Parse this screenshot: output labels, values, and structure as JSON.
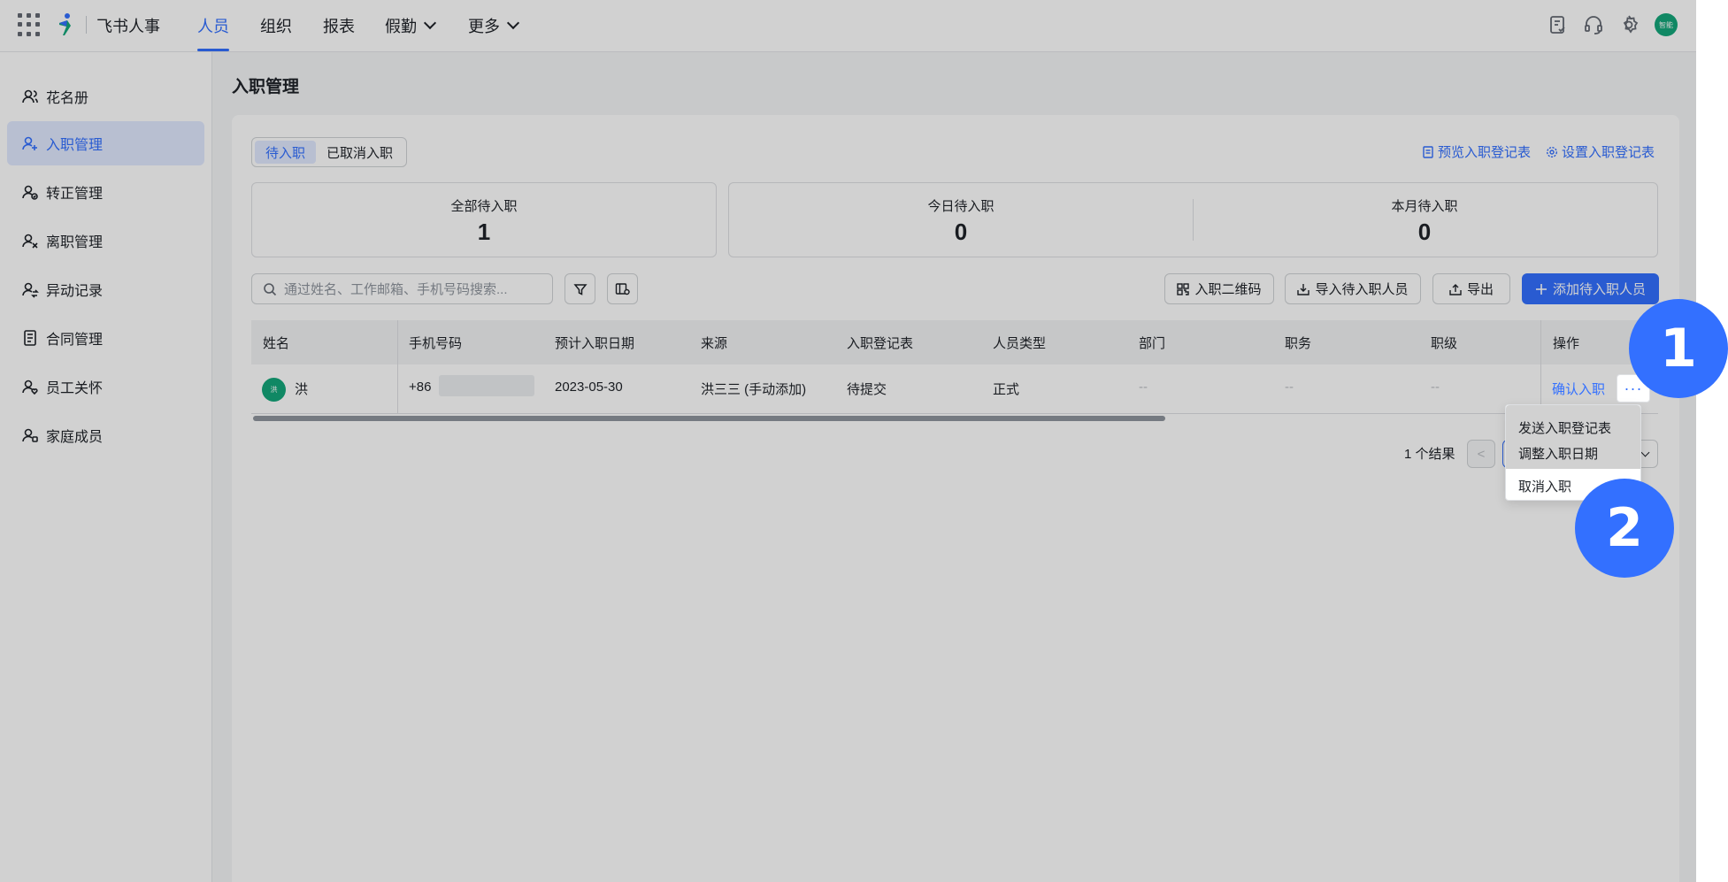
{
  "topbar": {
    "brand": "飞书人事",
    "nav": [
      "人员",
      "组织",
      "报表",
      "假勤",
      "更多"
    ],
    "avatar_text": "智能"
  },
  "sidebar": {
    "items": [
      {
        "label": "花名册",
        "icon": "roster-icon"
      },
      {
        "label": "入职管理",
        "icon": "onboarding-icon"
      },
      {
        "label": "转正管理",
        "icon": "regularization-icon"
      },
      {
        "label": "离职管理",
        "icon": "offboarding-icon"
      },
      {
        "label": "异动记录",
        "icon": "transfer-icon"
      },
      {
        "label": "合同管理",
        "icon": "contract-icon"
      },
      {
        "label": "员工关怀",
        "icon": "care-icon"
      },
      {
        "label": "家庭成员",
        "icon": "family-icon"
      }
    ]
  },
  "page": {
    "title": "入职管理",
    "tabs": [
      "待入职",
      "已取消入职"
    ],
    "preview_link": "预览入职登记表",
    "settings_link": "设置入职登记表"
  },
  "stats": [
    {
      "label": "全部待入职",
      "value": "1"
    },
    {
      "label": "今日待入职",
      "value": "0"
    },
    {
      "label": "本月待入职",
      "value": "0"
    }
  ],
  "toolbar": {
    "search_placeholder": "通过姓名、工作邮箱、手机号码搜索...",
    "qr_button": "入职二维码",
    "import_button": "导入待入职人员",
    "export_button": "导出",
    "add_button": "添加待入职人员"
  },
  "table": {
    "headers": [
      "姓名",
      "手机号码",
      "预计入职日期",
      "来源",
      "入职登记表",
      "人员类型",
      "部门",
      "职务",
      "职级",
      "操作"
    ],
    "rows": [
      {
        "avatar": "洪",
        "name": "洪",
        "phone": "+86",
        "date": "2023-05-30",
        "source": "洪三三 (手动添加)",
        "form_status": "待提交",
        "type": "正式",
        "dept": "--",
        "position": "--",
        "level": "--",
        "action": "确认入职",
        "more": "···"
      }
    ]
  },
  "pagination": {
    "result_text": "1 个结果",
    "prev": "<"
  },
  "dropdown": {
    "items": [
      "发送入职登记表",
      "调整入职日期",
      "取消入职"
    ]
  },
  "annotations": [
    "1",
    "2"
  ],
  "colors": {
    "accent": "#3370ff",
    "avatar": "#14a77a",
    "badge": "#3370ff"
  }
}
